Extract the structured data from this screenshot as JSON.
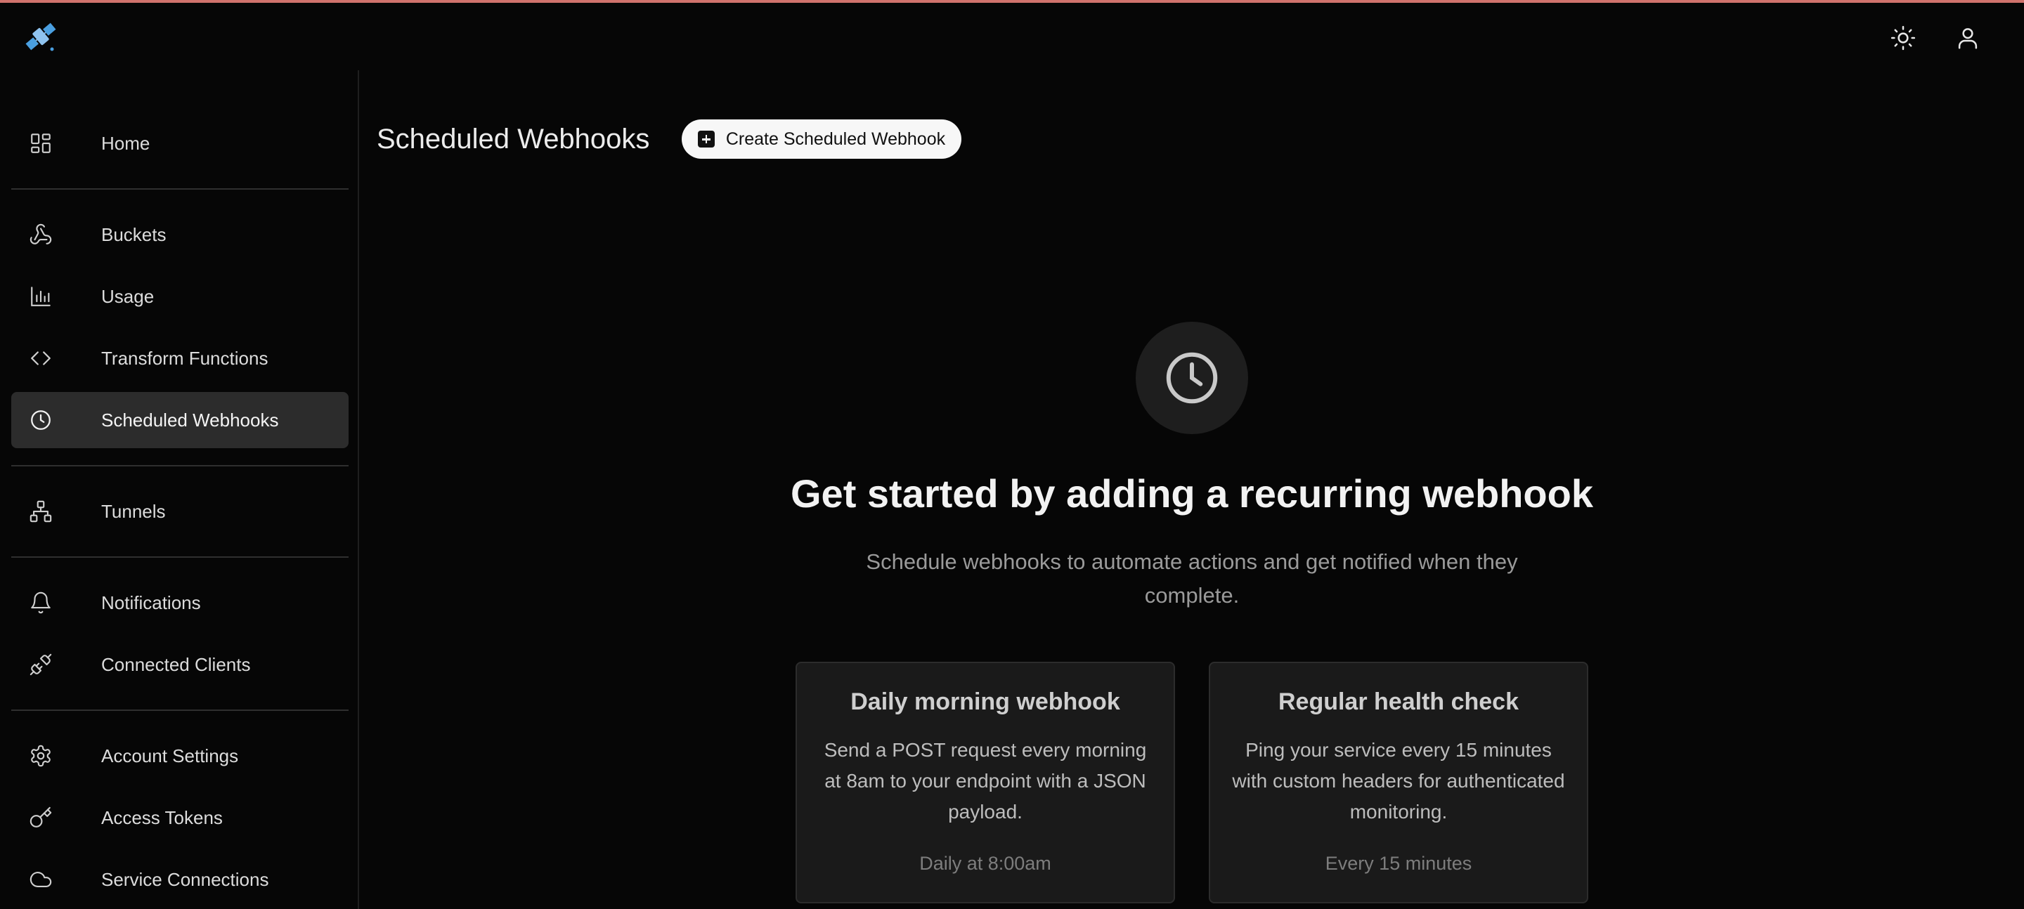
{
  "colors": {
    "accent_bar": "#d0726c",
    "logo_blue": "#4a9fe0"
  },
  "header": {
    "logo_icon": "satellite-logo-icon",
    "theme_icon": "sun-icon",
    "account_icon": "user-icon"
  },
  "sidebar": {
    "items": [
      {
        "label": "Home",
        "icon": "grid-icon"
      },
      {
        "label": "Buckets",
        "icon": "webhook-icon"
      },
      {
        "label": "Usage",
        "icon": "bar-chart-icon"
      },
      {
        "label": "Transform Functions",
        "icon": "code-icon"
      },
      {
        "label": "Scheduled Webhooks",
        "icon": "clock-icon",
        "active": true
      },
      {
        "label": "Tunnels",
        "icon": "network-icon"
      },
      {
        "label": "Notifications",
        "icon": "bell-icon"
      },
      {
        "label": "Connected Clients",
        "icon": "plug-icon"
      },
      {
        "label": "Account Settings",
        "icon": "gear-icon"
      },
      {
        "label": "Access Tokens",
        "icon": "key-icon"
      },
      {
        "label": "Service Connections",
        "icon": "cloud-icon"
      }
    ]
  },
  "main": {
    "title": "Scheduled Webhooks",
    "create_button": "Create Scheduled Webhook",
    "empty_state": {
      "icon": "clock-icon",
      "headline": "Get started by adding a recurring webhook",
      "subtext": "Schedule webhooks to automate actions and get notified when they complete."
    },
    "examples": [
      {
        "title": "Daily morning webhook",
        "description": "Send a POST request every morning at 8am to your endpoint with a JSON payload.",
        "schedule": "Daily at 8:00am"
      },
      {
        "title": "Regular health check",
        "description": "Ping your service every 15 minutes with custom headers for authenticated monitoring.",
        "schedule": "Every 15 minutes"
      }
    ]
  }
}
